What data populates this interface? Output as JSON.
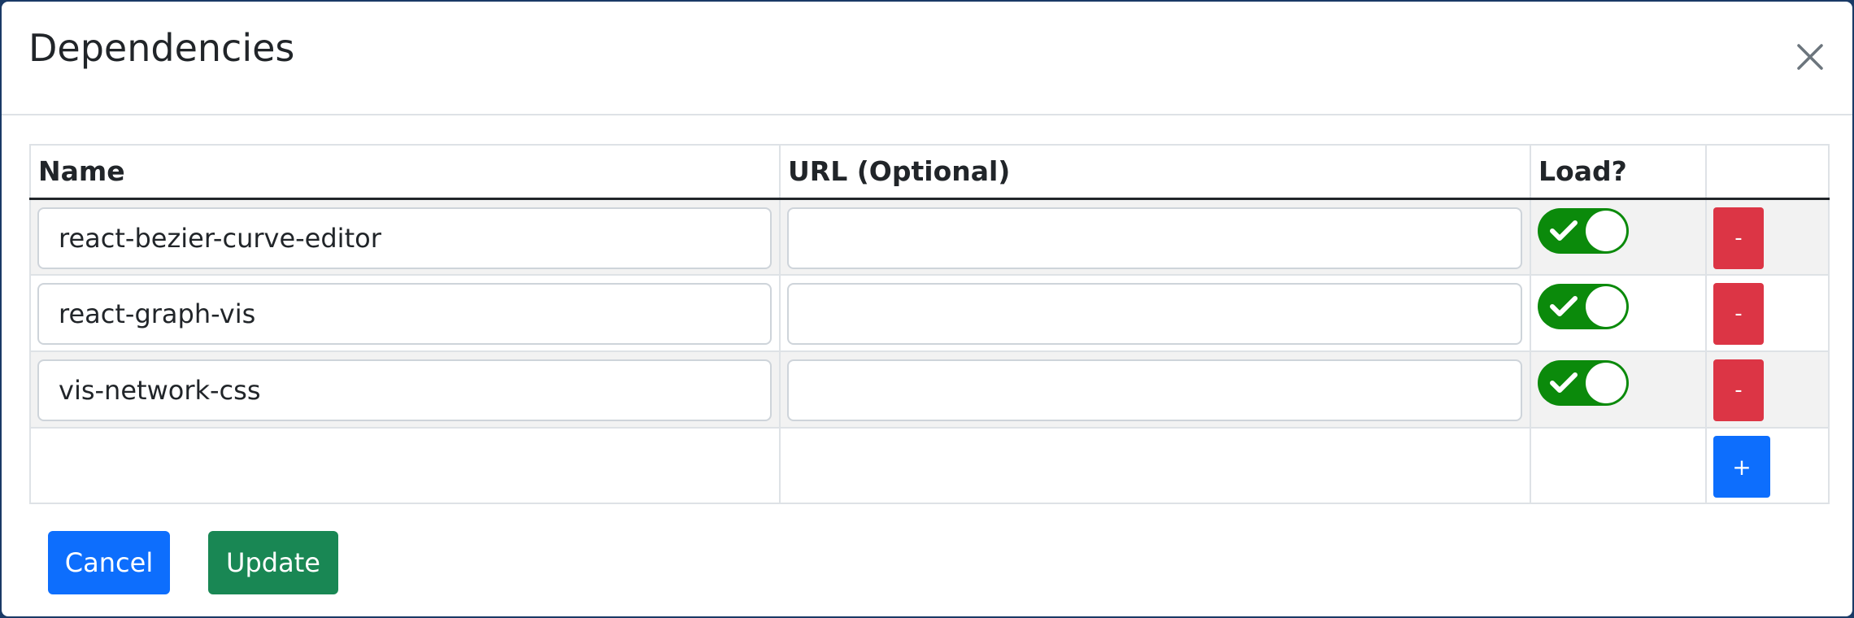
{
  "modal": {
    "title": "Dependencies",
    "close_icon": "close-icon"
  },
  "table": {
    "headers": {
      "name": "Name",
      "url": "URL (Optional)",
      "load": "Load?",
      "actions": ""
    },
    "rows": [
      {
        "name": "react-bezier-curve-editor",
        "url": "",
        "load": true,
        "remove_label": "-"
      },
      {
        "name": "react-graph-vis",
        "url": "",
        "load": true,
        "remove_label": "-"
      },
      {
        "name": "vis-network-css",
        "url": "",
        "load": true,
        "remove_label": "-"
      }
    ],
    "add_label": "+"
  },
  "footer": {
    "cancel_label": "Cancel",
    "update_label": "Update"
  },
  "colors": {
    "toggle_on": "#0b8a0b",
    "remove_button": "#dc3545",
    "primary_button": "#0d6efd",
    "update_button": "#198754",
    "striped_row": "#f2f2f2"
  },
  "icons": {
    "toggle_check": "check-icon"
  }
}
